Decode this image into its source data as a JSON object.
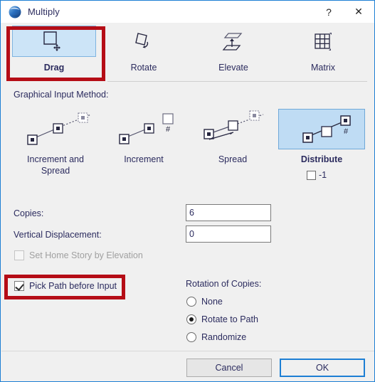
{
  "window": {
    "title": "Multiply",
    "app_icon": "archicad-sphere-icon",
    "help_label": "?",
    "close_label": "✕",
    "border_color": "#1d7fd4"
  },
  "tabs": [
    {
      "label": "Drag",
      "icon": "drag-move-icon",
      "selected": true
    },
    {
      "label": "Rotate",
      "icon": "rotate-icon",
      "selected": false
    },
    {
      "label": "Elevate",
      "icon": "elevate-icon",
      "selected": false
    },
    {
      "label": "Matrix",
      "icon": "matrix-grid-icon",
      "selected": false
    }
  ],
  "graphical_input": {
    "section_label": "Graphical Input Method:",
    "methods": [
      {
        "label": "Increment and\nSpread",
        "icon": "increment-and-spread-icon",
        "selected": false
      },
      {
        "label": "Increment",
        "icon": "increment-icon",
        "selected": false
      },
      {
        "label": "Spread",
        "icon": "spread-icon",
        "selected": false
      },
      {
        "label": "Distribute",
        "icon": "distribute-icon",
        "selected": true
      }
    ],
    "distribute_option": {
      "label": "-1",
      "checkbox": "distribute-minus-one-checkbox",
      "checked": false
    }
  },
  "fields": {
    "copies": {
      "label": "Copies:",
      "value": "6"
    },
    "vertical_displacement": {
      "label": "Vertical Displacement:",
      "value": "0"
    }
  },
  "checkboxes": {
    "set_home_story": {
      "label": "Set Home Story by Elevation",
      "checked": false,
      "disabled": true
    },
    "pick_path_before_input": {
      "label": "Pick Path before Input",
      "checked": true,
      "disabled": false
    }
  },
  "rotation_of_copies": {
    "title": "Rotation of Copies:",
    "options": [
      {
        "label": "None",
        "selected": false
      },
      {
        "label": "Rotate to Path",
        "selected": true
      },
      {
        "label": "Randomize",
        "selected": false
      }
    ]
  },
  "footer": {
    "cancel_label": "Cancel",
    "ok_label": "OK",
    "default_button": "OK"
  },
  "annotations": {
    "highlight_color": "#b50d16",
    "boxes": [
      {
        "target": "drag-tab"
      },
      {
        "target": "pick-path-before-input-checkbox"
      }
    ]
  },
  "colors": {
    "dialog_background": "#f0f0f0",
    "selection_fill": "#cce4f7",
    "selection_fill_strong": "#bfdcf4",
    "selection_border": "#7eb4e0",
    "text": "#2b2b5e",
    "accent": "#1d7fd4"
  }
}
